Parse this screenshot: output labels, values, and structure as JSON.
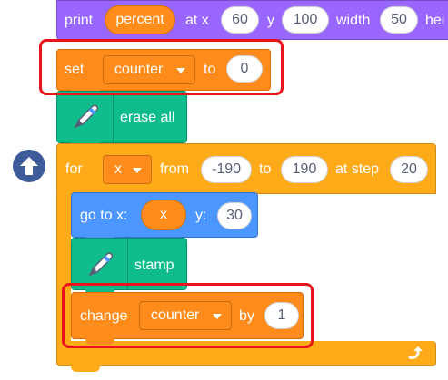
{
  "print_block": {
    "label": "print",
    "reporter": "percent",
    "at_x_label": "at x",
    "x_value": "60",
    "y_label": "y",
    "y_value": "100",
    "width_label": "width",
    "width_value": "50",
    "height_label_partial": "hei"
  },
  "set_block": {
    "label": "set",
    "variable": "counter",
    "to_label": "to",
    "value": "0"
  },
  "erase_block": {
    "label": "erase all"
  },
  "for_block": {
    "label": "for",
    "variable": "x",
    "from_label": "from",
    "from_value": "-190",
    "to_label": "to",
    "to_value": "190",
    "step_label": "at step",
    "step_value": "20"
  },
  "goto_block": {
    "label": "go to x:",
    "x_reporter": "x",
    "y_label": "y:",
    "y_value": "30"
  },
  "stamp_block": {
    "label": "stamp"
  },
  "change_block": {
    "label": "change",
    "variable": "counter",
    "by_label": "by",
    "value": "1"
  },
  "colors": {
    "looks": "#9966FF",
    "variables": "#FF8C1A",
    "control": "#FFAB19",
    "pen": "#0FBD8C",
    "motion": "#4C97FF",
    "highlight": "#E8141B"
  },
  "icons": {
    "arrow_up": "arrow-up-icon",
    "pen": "pen-icon",
    "loop": "loop-arrow-icon"
  }
}
